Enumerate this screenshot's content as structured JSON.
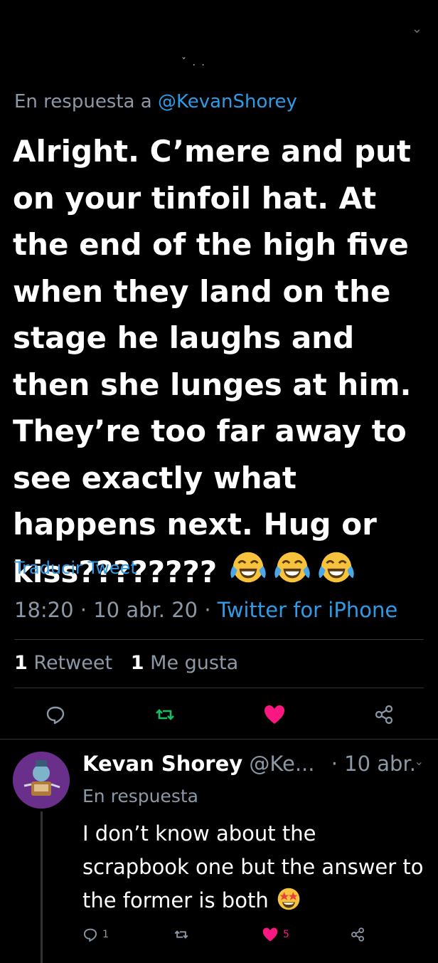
{
  "tweet": {
    "reply_prefix": "En respuesta a",
    "reply_handle": "@KevanShorey",
    "text": "Alright. C’mere and put on your tinfoil hat. At the end of the high five when they land on the stage he laughs and then she lunges at him. They’re too far away to see exactly what happens next. Hug or kiss????????",
    "emojis": [
      "laughing-tears-emoji",
      "laughing-tears-emoji",
      "laughing-tears-emoji"
    ],
    "translate_label": "Traducir Tweet",
    "time": "18:20",
    "date": "10 abr. 20",
    "separator": "·",
    "client": "Twitter for iPhone",
    "retweets_count": "1",
    "retweets_label": "Retweet",
    "likes_count": "1",
    "likes_label": "Me gusta"
  },
  "actions": {
    "icons": [
      "reply-icon",
      "retweet-icon",
      "like-icon",
      "share-icon"
    ],
    "colors": {
      "retweet": "#17bf63",
      "like": "#f91880",
      "muted": "#8b98a5"
    }
  },
  "reply": {
    "name": "Kevan Shorey",
    "handle": "@Ke...",
    "time": "· 10 abr.",
    "reply_prefix": "En respuesta",
    "text": "I don’t know about the scrapbook one but the answer to the former is both",
    "emoji": "star-struck-emoji",
    "replies_count": "1",
    "likes_count": "5"
  }
}
